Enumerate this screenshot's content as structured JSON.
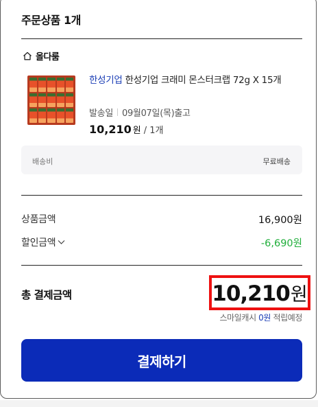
{
  "header": {
    "title": "주문상품 1개"
  },
  "store": {
    "name": "올다룸",
    "icon": "home-icon"
  },
  "product": {
    "brand": "한성기업",
    "name": "한성기업 크래미 몬스터크랩 72g X 15개",
    "ship_label": "발송일",
    "ship_date": "09월07일(목)출고",
    "price": "10,210",
    "price_unit": "원",
    "qty": "/ 1개"
  },
  "delivery": {
    "label": "배송비",
    "value": "무료배송"
  },
  "summary": {
    "goods_label": "상품금액",
    "goods_value": "16,900원",
    "discount_label": "할인금액",
    "discount_value": "-6,690원"
  },
  "total": {
    "label": "총 결제금액",
    "amount": "10,210",
    "unit": "원",
    "smile_prefix": "스마일캐시",
    "smile_amount": "0원",
    "smile_suffix": "적립예정"
  },
  "pay_button": {
    "label": "결제하기"
  },
  "colors": {
    "accent_blue": "#0b2bb8",
    "brand_blue": "#1a3db5",
    "discount_green": "#1fae3a",
    "highlight_red": "#ee1111"
  }
}
